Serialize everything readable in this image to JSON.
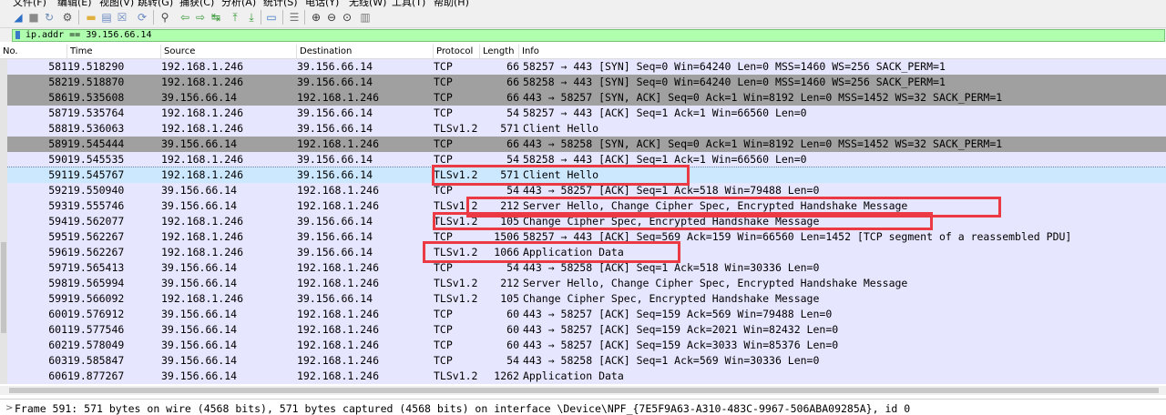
{
  "menu": [
    "文件(F)",
    "编辑(E)",
    "视图(V)",
    "跳转(G)",
    "捕获(C)",
    "分析(A)",
    "统计(S)",
    "电话(Y)",
    "无线(W)",
    "工具(T)",
    "帮助(H)"
  ],
  "toolbar_icons": [
    "shark-fin-start-icon",
    "stop-icon",
    "restart-icon",
    "options-gear-icon",
    "open-folder-icon",
    "save-file-icon",
    "close-file-icon",
    "reload-icon",
    "find-icon",
    "go-back-icon",
    "go-forward-icon",
    "go-to-packet-icon",
    "go-first-icon",
    "go-last-icon",
    "autoscroll-icon",
    "colorize-icon",
    "zoom-in-icon",
    "zoom-out-icon",
    "zoom-normal-icon",
    "resize-columns-icon"
  ],
  "filter": {
    "value": "ip.addr == 39.156.66.14"
  },
  "columns": [
    "No.",
    "Time",
    "Source",
    "Destination",
    "Protocol",
    "Length",
    "Info"
  ],
  "colors": {
    "dark_gray": "#a0a0a0",
    "lavender": "#e7e6ff",
    "selected": "#cce8ff",
    "filter_green": "#afffaf",
    "annotation_red": "#ec3a44"
  },
  "packets": [
    {
      "no": "581",
      "time": "19.518290",
      "src": "192.168.1.246",
      "dst": "39.156.66.14",
      "proto": "TCP",
      "len": "66",
      "info": "58257 → 443 [SYN] Seq=0 Win=64240 Len=0 MSS=1460 WS=256 SACK_PERM=1",
      "style": "lavender"
    },
    {
      "no": "582",
      "time": "19.518870",
      "src": "192.168.1.246",
      "dst": "39.156.66.14",
      "proto": "TCP",
      "len": "66",
      "info": "58258 → 443 [SYN] Seq=0 Win=64240 Len=0 MSS=1460 WS=256 SACK_PERM=1",
      "style": "dark"
    },
    {
      "no": "586",
      "time": "19.535608",
      "src": "39.156.66.14",
      "dst": "192.168.1.246",
      "proto": "TCP",
      "len": "66",
      "info": "443 → 58257 [SYN, ACK] Seq=0 Ack=1 Win=8192 Len=0 MSS=1452 WS=32 SACK_PERM=1",
      "style": "dark"
    },
    {
      "no": "587",
      "time": "19.535764",
      "src": "192.168.1.246",
      "dst": "39.156.66.14",
      "proto": "TCP",
      "len": "54",
      "info": "58257 → 443 [ACK] Seq=1 Ack=1 Win=66560 Len=0",
      "style": "lavender"
    },
    {
      "no": "588",
      "time": "19.536063",
      "src": "192.168.1.246",
      "dst": "39.156.66.14",
      "proto": "TLSv1.2",
      "len": "571",
      "info": "Client Hello",
      "style": "lavender"
    },
    {
      "no": "589",
      "time": "19.545444",
      "src": "39.156.66.14",
      "dst": "192.168.1.246",
      "proto": "TCP",
      "len": "66",
      "info": "443 → 58258 [SYN, ACK] Seq=0 Ack=1 Win=8192 Len=0 MSS=1452 WS=32 SACK_PERM=1",
      "style": "dark"
    },
    {
      "no": "590",
      "time": "19.545535",
      "src": "192.168.1.246",
      "dst": "39.156.66.14",
      "proto": "TCP",
      "len": "54",
      "info": "58258 → 443 [ACK] Seq=1 Ack=1 Win=66560 Len=0",
      "style": "lavender"
    },
    {
      "no": "591",
      "time": "19.545767",
      "src": "192.168.1.246",
      "dst": "39.156.66.14",
      "proto": "TLSv1.2",
      "len": "571",
      "info": "Client Hello",
      "style": "selected"
    },
    {
      "no": "592",
      "time": "19.550940",
      "src": "39.156.66.14",
      "dst": "192.168.1.246",
      "proto": "TCP",
      "len": "54",
      "info": "443 → 58257 [ACK] Seq=1 Ack=518 Win=79488 Len=0",
      "style": "lavender"
    },
    {
      "no": "593",
      "time": "19.555746",
      "src": "39.156.66.14",
      "dst": "192.168.1.246",
      "proto": "TLSv1.2",
      "len": "212",
      "info": "Server Hello, Change Cipher Spec, Encrypted Handshake Message",
      "style": "lavender"
    },
    {
      "no": "594",
      "time": "19.562077",
      "src": "192.168.1.246",
      "dst": "39.156.66.14",
      "proto": "TLSv1.2",
      "len": "105",
      "info": "Change Cipher Spec, Encrypted Handshake Message",
      "style": "lavender"
    },
    {
      "no": "595",
      "time": "19.562267",
      "src": "192.168.1.246",
      "dst": "39.156.66.14",
      "proto": "TCP",
      "len": "1506",
      "info": "58257 → 443 [ACK] Seq=569 Ack=159 Win=66560 Len=1452 [TCP segment of a reassembled PDU]",
      "style": "lavender"
    },
    {
      "no": "596",
      "time": "19.562267",
      "src": "192.168.1.246",
      "dst": "39.156.66.14",
      "proto": "TLSv1.2",
      "len": "1066",
      "info": "Application Data",
      "style": "lavender"
    },
    {
      "no": "597",
      "time": "19.565413",
      "src": "39.156.66.14",
      "dst": "192.168.1.246",
      "proto": "TCP",
      "len": "54",
      "info": "443 → 58258 [ACK] Seq=1 Ack=518 Win=30336 Len=0",
      "style": "lavender"
    },
    {
      "no": "598",
      "time": "19.565994",
      "src": "39.156.66.14",
      "dst": "192.168.1.246",
      "proto": "TLSv1.2",
      "len": "212",
      "info": "Server Hello, Change Cipher Spec, Encrypted Handshake Message",
      "style": "lavender"
    },
    {
      "no": "599",
      "time": "19.566092",
      "src": "192.168.1.246",
      "dst": "39.156.66.14",
      "proto": "TLSv1.2",
      "len": "105",
      "info": "Change Cipher Spec, Encrypted Handshake Message",
      "style": "lavender"
    },
    {
      "no": "600",
      "time": "19.576912",
      "src": "39.156.66.14",
      "dst": "192.168.1.246",
      "proto": "TCP",
      "len": "60",
      "info": "443 → 58257 [ACK] Seq=159 Ack=569 Win=79488 Len=0",
      "style": "lavender"
    },
    {
      "no": "601",
      "time": "19.577546",
      "src": "39.156.66.14",
      "dst": "192.168.1.246",
      "proto": "TCP",
      "len": "60",
      "info": "443 → 58257 [ACK] Seq=159 Ack=2021 Win=82432 Len=0",
      "style": "lavender"
    },
    {
      "no": "602",
      "time": "19.578049",
      "src": "39.156.66.14",
      "dst": "192.168.1.246",
      "proto": "TCP",
      "len": "60",
      "info": "443 → 58257 [ACK] Seq=159 Ack=3033 Win=85376 Len=0",
      "style": "lavender"
    },
    {
      "no": "603",
      "time": "19.585847",
      "src": "39.156.66.14",
      "dst": "192.168.1.246",
      "proto": "TCP",
      "len": "54",
      "info": "443 → 58258 [ACK] Seq=1 Ack=569 Win=30336 Len=0",
      "style": "lavender"
    },
    {
      "no": "606",
      "time": "19.877267",
      "src": "39.156.66.14",
      "dst": "192.168.1.246",
      "proto": "TLSv1.2",
      "len": "1262",
      "info": "Application Data",
      "style": "lavender"
    }
  ],
  "details": {
    "expander": ">",
    "frame_summary": "Frame 591: 571 bytes on wire (4568 bits), 571 bytes captured (4568 bits) on interface \\Device\\NPF_{7E5F9A63-A310-483C-9967-506ABA09285A}, id 0"
  }
}
